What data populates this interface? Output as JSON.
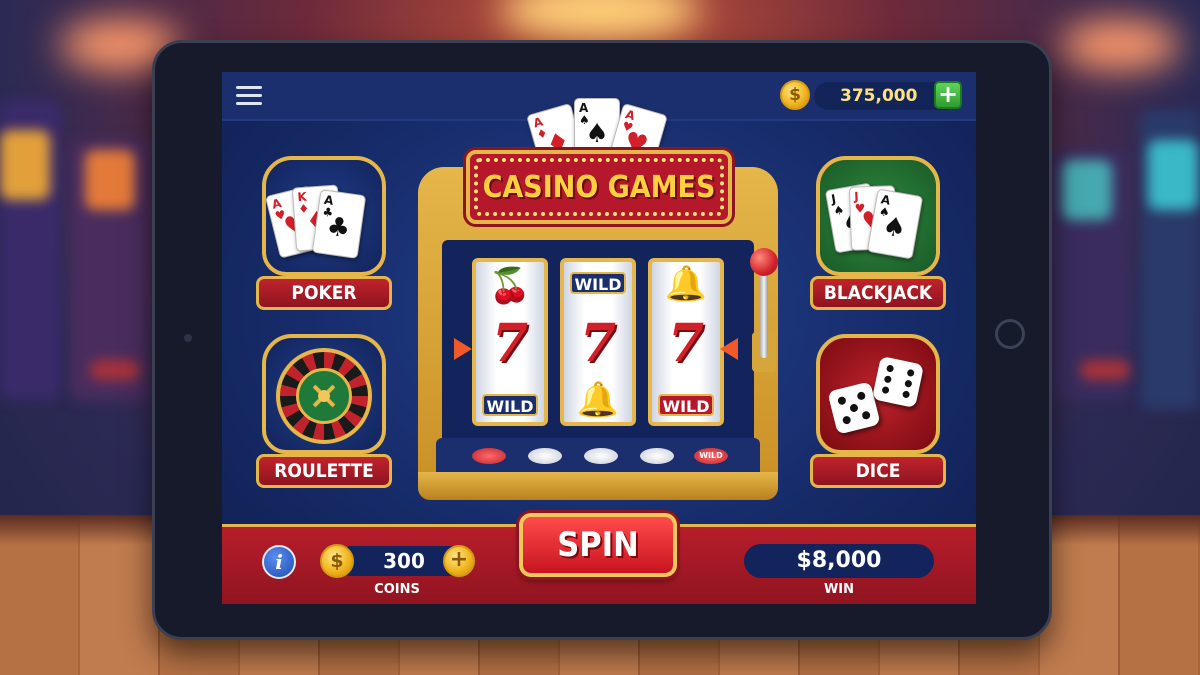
{
  "header": {
    "balance": "375,000",
    "coin_symbol": "$",
    "add_symbol": "+"
  },
  "machine": {
    "title": "CASINO GAMES",
    "reels": [
      {
        "top": "cherry",
        "middle": "7",
        "bottom": "WILD"
      },
      {
        "top": "WILD",
        "middle": "7",
        "bottom": "bell"
      },
      {
        "top": "bell",
        "middle": "7",
        "bottom": "WILD"
      }
    ],
    "button_wild_label": "WILD"
  },
  "games": {
    "poker": "POKER",
    "roulette": "ROULETTE",
    "blackjack": "BLACKJACK",
    "dice": "DICE"
  },
  "footer": {
    "info_symbol": "i",
    "coin_symbol": "$",
    "coins_value": "300",
    "coins_plus": "+",
    "coins_label": "COINS",
    "spin_label": "SPIN",
    "win_value": "$8,000",
    "win_label": "WIN"
  },
  "colors": {
    "gold": "#e5b64a",
    "red": "#c0232c",
    "navy": "#172c6b"
  }
}
